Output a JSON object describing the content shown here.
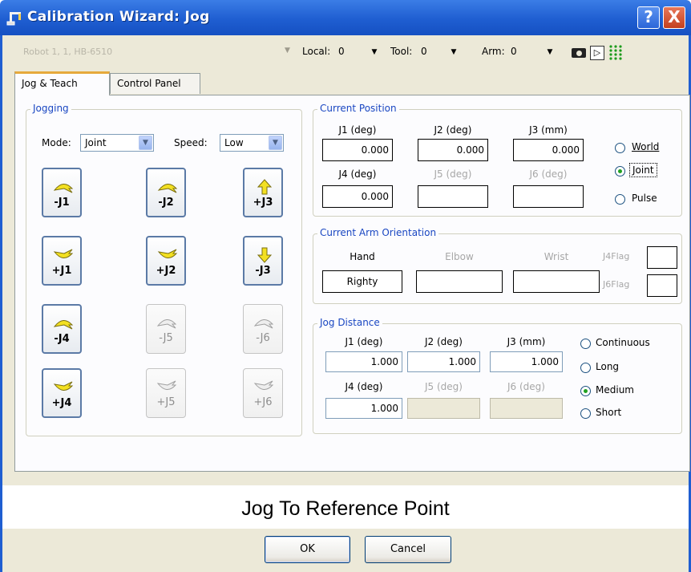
{
  "window": {
    "title": "Calibration Wizard: Jog",
    "help": "?",
    "close": "X"
  },
  "toolbar": {
    "robot": "Robot 1, 1, HB-6510",
    "local_label": "Local:",
    "local_value": "0",
    "tool_label": "Tool:",
    "tool_value": "0",
    "arm_label": "Arm:",
    "arm_value": "0"
  },
  "tabs": [
    "Jog & Teach",
    "Control Panel"
  ],
  "jogging": {
    "title": "Jogging",
    "mode_label": "Mode:",
    "mode_value": "Joint",
    "speed_label": "Speed:",
    "speed_value": "Low",
    "buttons": [
      {
        "label": "-J1",
        "enabled": true,
        "icon": "curved-arrow-up-icon"
      },
      {
        "label": "-J2",
        "enabled": true,
        "icon": "curved-arrow-up-icon"
      },
      {
        "label": "+J3",
        "enabled": true,
        "icon": "arrow-up-icon"
      },
      {
        "label": "+J1",
        "enabled": true,
        "icon": "curved-arrow-down-icon"
      },
      {
        "label": "+J2",
        "enabled": true,
        "icon": "curved-arrow-down-icon"
      },
      {
        "label": "-J3",
        "enabled": true,
        "icon": "arrow-down-icon"
      },
      {
        "label": "-J4",
        "enabled": true,
        "icon": "curved-arrow-up-icon"
      },
      {
        "label": "-J5",
        "enabled": false,
        "icon": "curved-arrow-up-icon"
      },
      {
        "label": "-J6",
        "enabled": false,
        "icon": "curved-arrow-up-icon"
      },
      {
        "label": "+J4",
        "enabled": true,
        "icon": "curved-arrow-down-icon"
      },
      {
        "label": "+J5",
        "enabled": false,
        "icon": "curved-arrow-down-icon"
      },
      {
        "label": "+J6",
        "enabled": false,
        "icon": "curved-arrow-down-icon"
      }
    ]
  },
  "current_position": {
    "title": "Current Position",
    "headers": [
      "J1 (deg)",
      "J2 (deg)",
      "J3 (mm)",
      "J4 (deg)",
      "J5 (deg)",
      "J6 (deg)"
    ],
    "values": [
      "0.000",
      "0.000",
      "0.000",
      "0.000",
      "",
      ""
    ],
    "modes": [
      "World",
      "Joint",
      "Pulse"
    ],
    "selected_mode": "Joint"
  },
  "arm_orientation": {
    "title": "Current Arm Orientation",
    "hand_label": "Hand",
    "hand_value": "Righty",
    "elbow_label": "Elbow",
    "elbow_value": "",
    "wrist_label": "Wrist",
    "wrist_value": "",
    "j4flag_label": "J4Flag",
    "j6flag_label": "J6Flag"
  },
  "jog_distance": {
    "title": "Jog Distance",
    "headers": [
      "J1 (deg)",
      "J2 (deg)",
      "J3 (mm)",
      "J4 (deg)",
      "J5 (deg)",
      "J6 (deg)"
    ],
    "values": [
      "1.000",
      "1.000",
      "1.000",
      "1.000",
      "",
      ""
    ],
    "options": [
      "Continuous",
      "Long",
      "Medium",
      "Short"
    ],
    "selected": "Medium"
  },
  "reference_text": "Jog To Reference Point",
  "buttons": {
    "ok": "OK",
    "cancel": "Cancel"
  },
  "colors": {
    "titlebar": "#1f5ed1",
    "group_title": "#1a47c2",
    "jog_icon": "#f3e021",
    "radio_dot": "#21a121"
  }
}
